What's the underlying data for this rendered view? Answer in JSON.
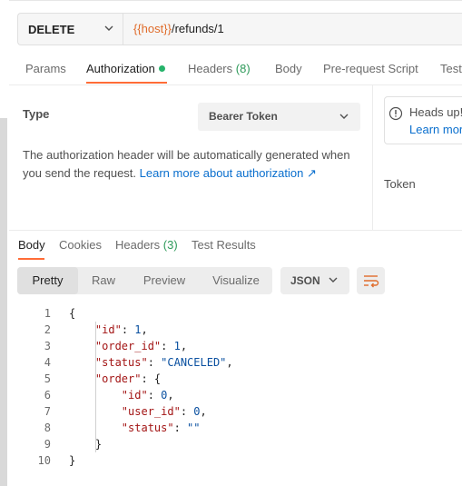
{
  "request": {
    "method": "DELETE",
    "url_var": "{{host}}",
    "url_path": "/refunds/1"
  },
  "request_tabs": [
    {
      "label": "Params"
    },
    {
      "label": "Authorization",
      "active": true,
      "dot": true
    },
    {
      "label": "Headers",
      "count": "(8)"
    },
    {
      "label": "Body"
    },
    {
      "label": "Pre-request Script"
    },
    {
      "label": "Test"
    }
  ],
  "auth": {
    "type_label": "Type",
    "type_value": "Bearer Token",
    "description": "The authorization header will be automatically generated when you send the request.",
    "learn_more": "Learn more about authorization ↗",
    "note_title": "Heads up!",
    "note_link": "Learn mor",
    "token_label": "Token"
  },
  "response_tabs": [
    {
      "label": "Body",
      "active": true
    },
    {
      "label": "Cookies"
    },
    {
      "label": "Headers",
      "count": "(3)"
    },
    {
      "label": "Test Results"
    }
  ],
  "view_modes": [
    "Pretty",
    "Raw",
    "Preview",
    "Visualize"
  ],
  "active_view": "Pretty",
  "format": "JSON",
  "code": {
    "line_numbers": [
      "1",
      "2",
      "3",
      "4",
      "5",
      "6",
      "7",
      "8",
      "9",
      "10"
    ],
    "lines": [
      "{",
      "    \"id\": 1,",
      "    \"order_id\": 1,",
      "    \"status\": \"CANCELED\",",
      "    \"order\": {",
      "        \"id\": 0,",
      "        \"user_id\": 0,",
      "        \"status\": \"\"",
      "    }",
      "}"
    ]
  },
  "colors": {
    "accent": "#ff6c37",
    "link": "#0a6fce",
    "success": "#26b36b",
    "json_key": "#a31515",
    "json_value": "#0a50a0"
  }
}
